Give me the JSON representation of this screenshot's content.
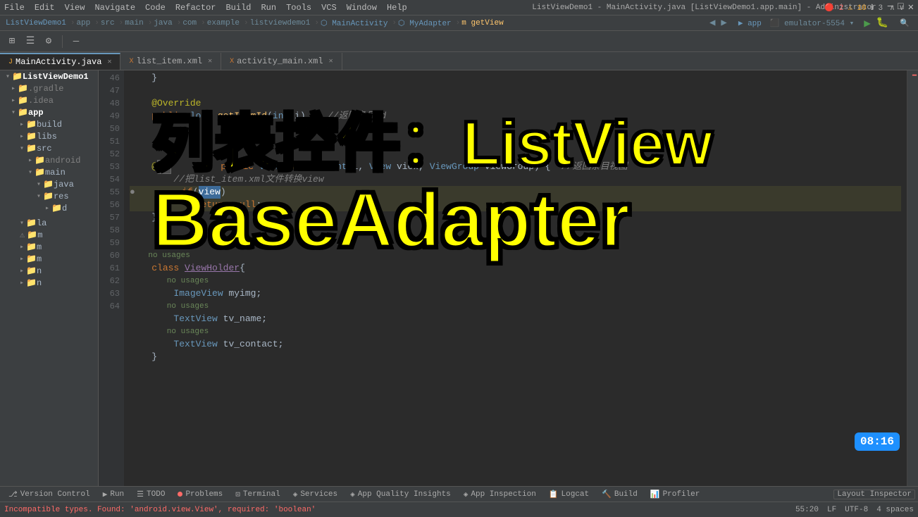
{
  "window": {
    "title": "ListViewDemo1 - MainActivity.java [ListViewDemo1.app.main] - Administrator",
    "minimize": "─",
    "maximize": "□",
    "close": "✕"
  },
  "menubar": {
    "items": [
      "File",
      "Edit",
      "View",
      "Navigate",
      "Code",
      "Refactor",
      "Build",
      "Run",
      "Tools",
      "VCS",
      "Window",
      "Help"
    ]
  },
  "breadcrumb": {
    "items": [
      "ListViewDemo1",
      "app",
      "src",
      "main",
      "java",
      "com",
      "example",
      "listviewdemo1",
      "MainActivity",
      "MyAdapter",
      "getView"
    ],
    "project": "ListViewDemo1"
  },
  "toolbar": {
    "app_name": "app",
    "device": "emulator-5554"
  },
  "tabs": [
    {
      "name": "MainActivity.java",
      "icon": "J",
      "active": true
    },
    {
      "name": "list_item.xml",
      "icon": "X",
      "active": false
    },
    {
      "name": "activity_main.xml",
      "icon": "X",
      "active": false
    }
  ],
  "sidebar": {
    "title": "ListViewDemo1",
    "items": [
      {
        "label": ".gradle",
        "indent": 1,
        "type": "folder"
      },
      {
        "label": ".idea",
        "indent": 1,
        "type": "folder"
      },
      {
        "label": "app",
        "indent": 1,
        "type": "folder-open",
        "bold": true
      },
      {
        "label": "build",
        "indent": 2,
        "type": "folder"
      },
      {
        "label": "libs",
        "indent": 2,
        "type": "folder"
      },
      {
        "label": "src",
        "indent": 2,
        "type": "folder-open"
      },
      {
        "label": "android",
        "indent": 3,
        "type": "folder"
      },
      {
        "label": "main",
        "indent": 3,
        "type": "folder-open"
      },
      {
        "label": "java",
        "indent": 4,
        "type": "folder-open"
      },
      {
        "label": "res",
        "indent": 4,
        "type": "folder-open"
      },
      {
        "label": "d",
        "indent": 5,
        "type": "folder"
      },
      {
        "label": "la",
        "indent": 2,
        "type": "folder"
      },
      {
        "label": "m",
        "indent": 2,
        "type": "file"
      },
      {
        "label": "m",
        "indent": 2,
        "type": "file"
      },
      {
        "label": "m",
        "indent": 2,
        "type": "file"
      },
      {
        "label": "n",
        "indent": 2,
        "type": "file"
      },
      {
        "label": "n",
        "indent": 2,
        "type": "file"
      }
    ]
  },
  "overlay": {
    "line1": "列表控件：ListView",
    "line2": "BaseAdapter"
  },
  "code": {
    "lines": [
      {
        "num": 46,
        "content": ""
      },
      {
        "num": 47,
        "content": ""
      },
      {
        "num": 48,
        "content": "    @Override",
        "type": "annotation"
      },
      {
        "num": 49,
        "content": "    public long getItemId(int i) {  //返回条目id",
        "type": "normal"
      },
      {
        "num": 50,
        "content": ""
      },
      {
        "num": 51,
        "content": ""
      },
      {
        "num": 52,
        "content": ""
      },
      {
        "num": 53,
        "content": "    @",
        "type": "normal"
      },
      {
        "num": 54,
        "content": "    //",
        "type": "comment"
      },
      {
        "num": 55,
        "content": "        if(view)",
        "type": "highlighted"
      },
      {
        "num": 56,
        "content": "            return null;",
        "type": "highlighted-yellow"
      },
      {
        "num": 57,
        "content": "    }",
        "type": "normal"
      },
      {
        "num": 58,
        "content": ""
      },
      {
        "num": 59,
        "content": ""
      },
      {
        "num": 60,
        "content": "    no usages",
        "type": "hint"
      },
      {
        "num": 61,
        "content": "    class ViewHolder{",
        "type": "normal"
      },
      {
        "num": -1,
        "content": "        no usages",
        "type": "hint"
      },
      {
        "num": -1,
        "content": "        ImageView myimg;",
        "type": "normal"
      },
      {
        "num": -1,
        "content": "        no usages",
        "type": "hint"
      },
      {
        "num": -1,
        "content": "        TextView tv_name;",
        "type": "normal"
      },
      {
        "num": -1,
        "content": "        no usages",
        "type": "hint"
      },
      {
        "num": 62,
        "content": "        TextView tv_contact;",
        "type": "normal"
      },
      {
        "num": 63,
        "content": "    }",
        "type": "normal"
      },
      {
        "num": 64,
        "content": ""
      }
    ],
    "getview_line": "    public View getView(int i, View view, ViewGroup viewGroup) {  //返回条目视图",
    "comment_line": "        把list_item.xml文件转换view"
  },
  "errors": {
    "error_count": "2",
    "warning_count": "10",
    "info_count": "3"
  },
  "status_bar": {
    "error_text": "Incompatible types. Found: 'android.view.View', required: 'boolean'",
    "position": "55:20",
    "line_sep": "LF",
    "encoding": "UTF-8",
    "indent": "4 spaces"
  },
  "bottom_tabs": [
    {
      "label": "Version Control",
      "icon": "git"
    },
    {
      "label": "Run",
      "icon": "run"
    },
    {
      "label": "TODO",
      "icon": "list"
    },
    {
      "label": "Problems",
      "icon": "dot-red",
      "count": ""
    },
    {
      "label": "Terminal",
      "icon": "terminal"
    },
    {
      "label": "Services",
      "icon": "services"
    },
    {
      "label": "App Quality Insights",
      "icon": "quality"
    },
    {
      "label": "App Inspection",
      "icon": "inspection"
    },
    {
      "label": "Logcat",
      "icon": "logcat"
    },
    {
      "label": "Build",
      "icon": "build"
    },
    {
      "label": "Profiler",
      "icon": "profiler"
    }
  ],
  "layout_inspector": "Layout Inspector",
  "time": "08:16"
}
